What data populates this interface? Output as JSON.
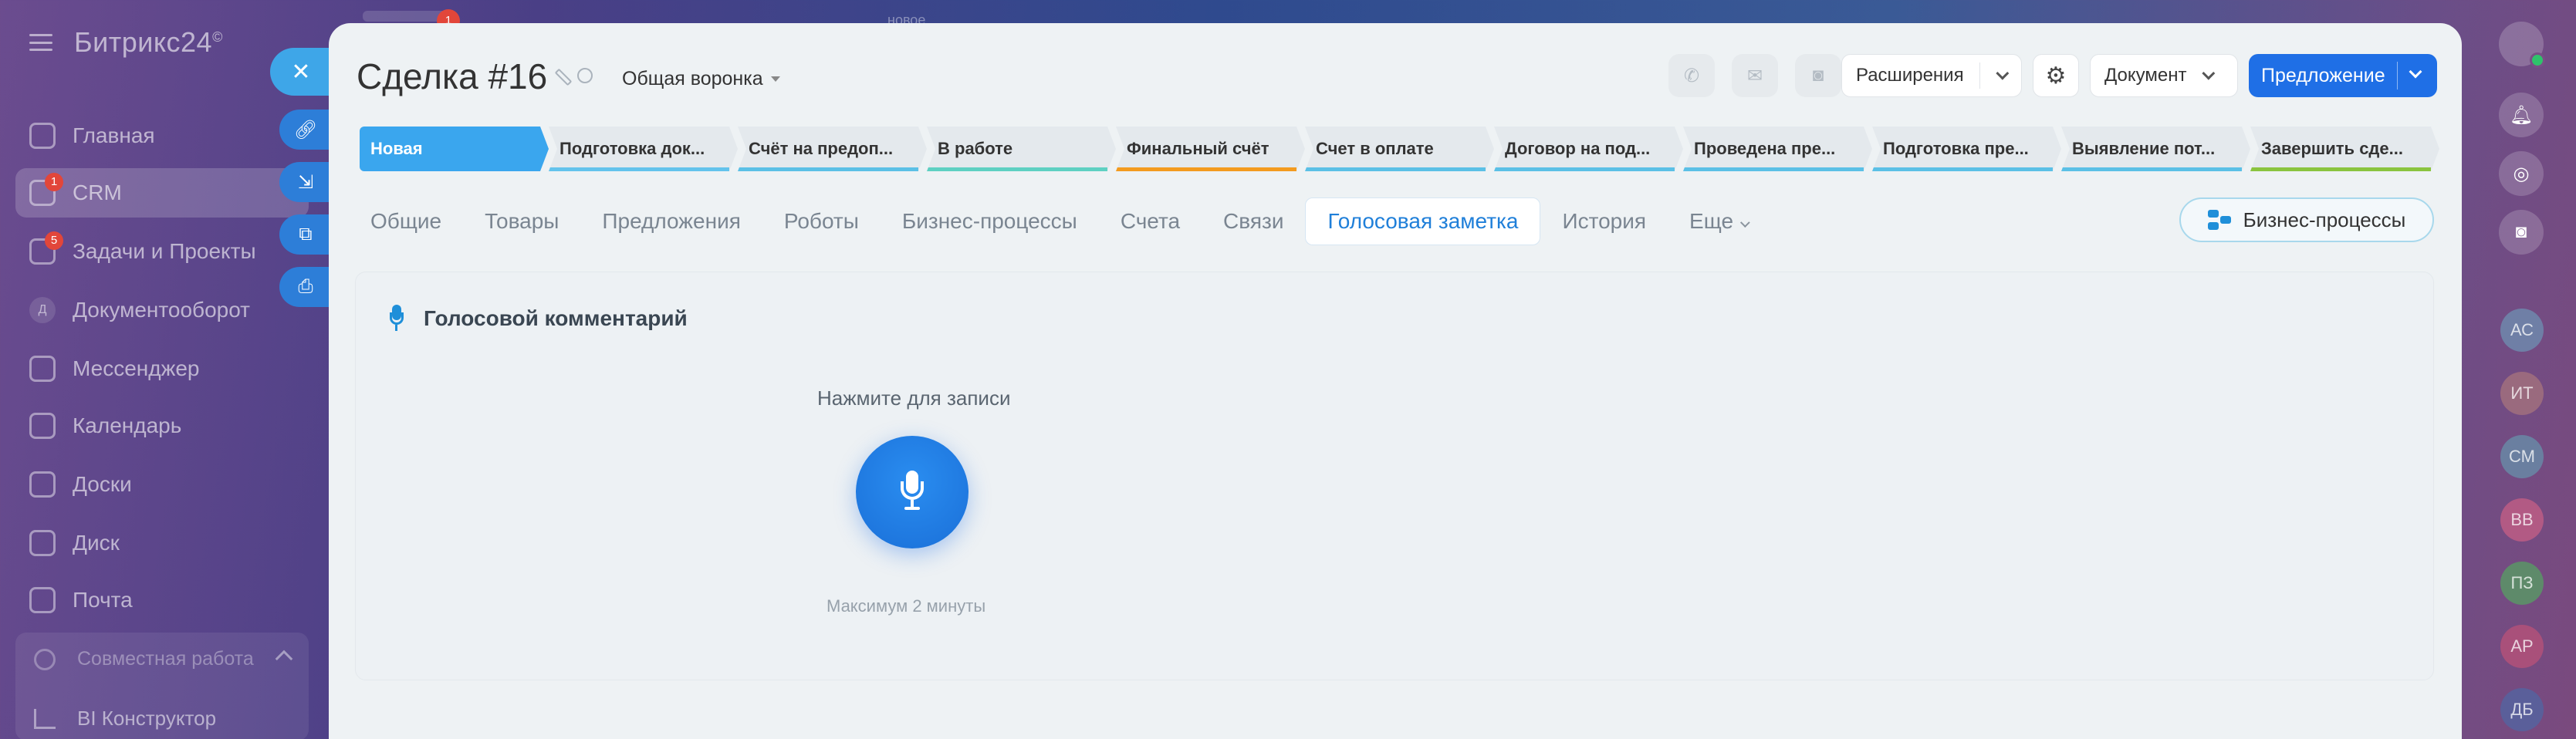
{
  "sidebar": {
    "logo": "Битрикс24",
    "logo_mark": "©",
    "items": [
      {
        "label": "Главная",
        "badge": ""
      },
      {
        "label": "CRM",
        "badge": "1"
      },
      {
        "label": "Задачи и Проекты",
        "badge": "5"
      },
      {
        "label": "Документооборот",
        "badge": "",
        "initial": "Д"
      },
      {
        "label": "Мессенджер",
        "badge": ""
      },
      {
        "label": "Календарь",
        "badge": ""
      },
      {
        "label": "Доски",
        "badge": ""
      },
      {
        "label": "Диск",
        "badge": ""
      },
      {
        "label": "Почта",
        "badge": ""
      }
    ],
    "group": {
      "title": "Совместная работа",
      "sub": "BI Конструктор"
    }
  },
  "topbar": {
    "badge": "1",
    "new_label": "новое"
  },
  "deal": {
    "title": "Сделка #16",
    "funnel": "Общая воронка",
    "buttons": {
      "extensions": "Расширения",
      "document": "Документ",
      "proposal": "Предложение"
    }
  },
  "stages": [
    {
      "label": "Новая",
      "color": "#3aa6ee",
      "active": true
    },
    {
      "label": "Подготовка док...",
      "color": "#63c3ec"
    },
    {
      "label": "Счёт на предоп...",
      "color": "#5bc0e6"
    },
    {
      "label": "В работе",
      "color": "#5ed0c2"
    },
    {
      "label": "Финальный счёт",
      "color": "#f39b1f"
    },
    {
      "label": "Счет в оплате",
      "color": "#5bc0e6"
    },
    {
      "label": "Договор на под...",
      "color": "#5bc0e6"
    },
    {
      "label": "Проведена пре...",
      "color": "#5bc0e6"
    },
    {
      "label": "Подготовка пре...",
      "color": "#5bc0e6"
    },
    {
      "label": "Выявление пот...",
      "color": "#5bc0e6"
    },
    {
      "label": "Завершить сде...",
      "color": "#8ac43f"
    }
  ],
  "tabs": [
    {
      "label": "Общие"
    },
    {
      "label": "Товары"
    },
    {
      "label": "Предложения"
    },
    {
      "label": "Роботы"
    },
    {
      "label": "Бизнес-процессы"
    },
    {
      "label": "Счета"
    },
    {
      "label": "Связи"
    },
    {
      "label": "Голосовая заметка",
      "active": true
    },
    {
      "label": "История"
    },
    {
      "label": "Еще"
    }
  ],
  "bp_button": "Бизнес-процессы",
  "voice": {
    "heading": "Голосовой комментарий",
    "prompt": "Нажмите для записи",
    "note": "Максимум 2 минуты"
  },
  "rightbar": {
    "users": [
      {
        "initials": "АС",
        "color": "#6f7fa6"
      },
      {
        "initials": "ИТ",
        "color": "#9a6a7e"
      },
      {
        "initials": "СМ",
        "color": "#6a7fa0"
      },
      {
        "initials": "ВВ",
        "color": "#b25a84"
      },
      {
        "initials": "ПЗ",
        "color": "#5e8a6a"
      },
      {
        "initials": "АР",
        "color": "#a9507a"
      },
      {
        "initials": "ДБ",
        "color": "#5a5f9a"
      }
    ]
  }
}
